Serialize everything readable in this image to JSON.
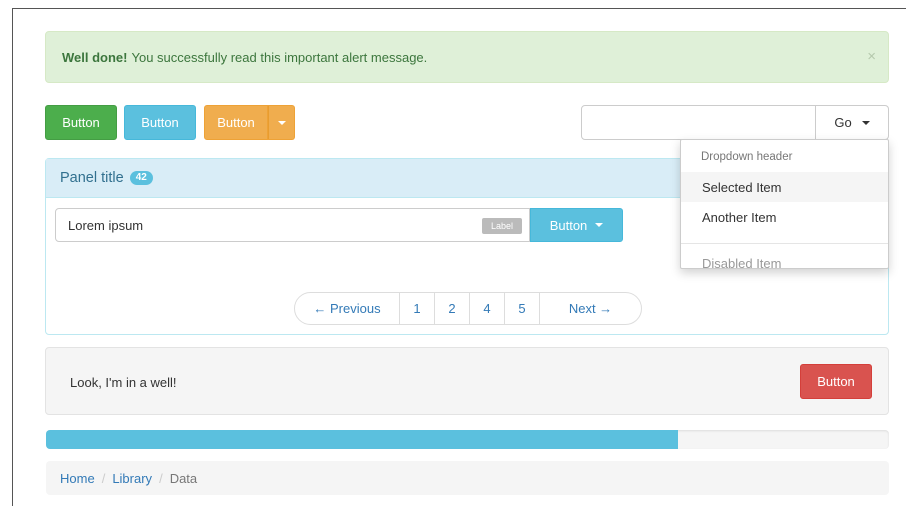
{
  "alert": {
    "strong": "Well done!",
    "message": "You successfully read this important alert message.",
    "close": "×"
  },
  "buttons": {
    "success": "Button",
    "info": "Button",
    "warning": "Button"
  },
  "search": {
    "value": "",
    "go_label": "Go"
  },
  "dropdown": {
    "header": "Dropdown header",
    "items": [
      "Selected Item",
      "Another Item"
    ],
    "disabled_item": "Disabled Item"
  },
  "panel": {
    "title": "Panel title",
    "badge": "42",
    "input_value": "Lorem ipsum",
    "input_label": "Label",
    "button": "Button"
  },
  "pagination": {
    "prev": "← Previous",
    "pages": [
      "1",
      "2",
      "4",
      "5"
    ],
    "next": "Next →"
  },
  "well": {
    "text": "Look, I'm in a well!",
    "button": "Button"
  },
  "progress": {
    "percent": 75
  },
  "breadcrumb": {
    "items": [
      "Home",
      "Library"
    ],
    "active": "Data",
    "separator": "/"
  }
}
